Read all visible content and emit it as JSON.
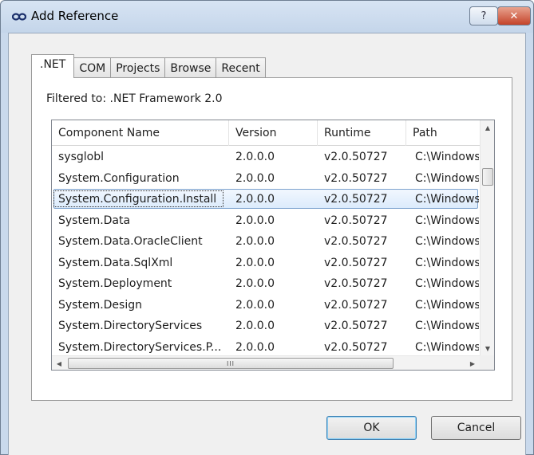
{
  "window": {
    "title": "Add Reference",
    "help_label": "?",
    "close_label": "✕"
  },
  "tabs": [
    {
      "label": ".NET",
      "active": true
    },
    {
      "label": "COM",
      "active": false
    },
    {
      "label": "Projects",
      "active": false
    },
    {
      "label": "Browse",
      "active": false
    },
    {
      "label": "Recent",
      "active": false
    }
  ],
  "filter_text": "Filtered to: .NET Framework 2.0",
  "list": {
    "columns": [
      "Component Name",
      "Version",
      "Runtime",
      "Path"
    ],
    "rows": [
      {
        "name": "sysglobl",
        "version": "2.0.0.0",
        "runtime": "v2.0.50727",
        "path": "C:\\Windows\\"
      },
      {
        "name": "System.Configuration",
        "version": "2.0.0.0",
        "runtime": "v2.0.50727",
        "path": "C:\\Windows\\"
      },
      {
        "name": "System.Configuration.Install",
        "version": "2.0.0.0",
        "runtime": "v2.0.50727",
        "path": "C:\\Windows\\"
      },
      {
        "name": "System.Data",
        "version": "2.0.0.0",
        "runtime": "v2.0.50727",
        "path": "C:\\Windows\\"
      },
      {
        "name": "System.Data.OracleClient",
        "version": "2.0.0.0",
        "runtime": "v2.0.50727",
        "path": "C:\\Windows\\"
      },
      {
        "name": "System.Data.SqlXml",
        "version": "2.0.0.0",
        "runtime": "v2.0.50727",
        "path": "C:\\Windows\\"
      },
      {
        "name": "System.Deployment",
        "version": "2.0.0.0",
        "runtime": "v2.0.50727",
        "path": "C:\\Windows\\"
      },
      {
        "name": "System.Design",
        "version": "2.0.0.0",
        "runtime": "v2.0.50727",
        "path": "C:\\Windows\\"
      },
      {
        "name": "System.DirectoryServices",
        "version": "2.0.0.0",
        "runtime": "v2.0.50727",
        "path": "C:\\Windows\\"
      },
      {
        "name": "System.DirectoryServices.P...",
        "version": "2.0.0.0",
        "runtime": "v2.0.50727",
        "path": "C:\\Windows\\"
      }
    ],
    "selected_row": "System.Configuration.Install"
  },
  "scrollbar": {
    "up_arrow": "▲",
    "down_arrow": "▼",
    "left_arrow": "◀",
    "right_arrow": "▶",
    "grip": "III"
  },
  "buttons": {
    "ok_label": "OK",
    "cancel_label": "Cancel"
  }
}
